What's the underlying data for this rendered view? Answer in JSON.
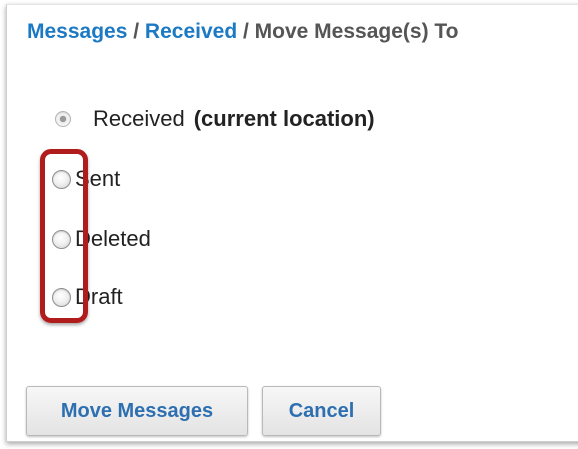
{
  "breadcrumb": {
    "items": [
      {
        "label": "Messages",
        "link": true
      },
      {
        "label": "Received",
        "link": true
      },
      {
        "label": "Move Message(s) To",
        "link": false
      }
    ],
    "separator": "/"
  },
  "move_options": {
    "items": [
      {
        "label": "Received",
        "note": "(current location)",
        "selected": true
      },
      {
        "label": "Sent",
        "note": "",
        "selected": false
      },
      {
        "label": "Deleted",
        "note": "",
        "selected": false
      },
      {
        "label": "Draft",
        "note": "",
        "selected": false
      }
    ]
  },
  "buttons": {
    "move_label": "Move Messages",
    "cancel_label": "Cancel"
  },
  "colors": {
    "link": "#1c79c4",
    "highlight": "#b01c1c",
    "button_text": "#2e6fb1"
  }
}
